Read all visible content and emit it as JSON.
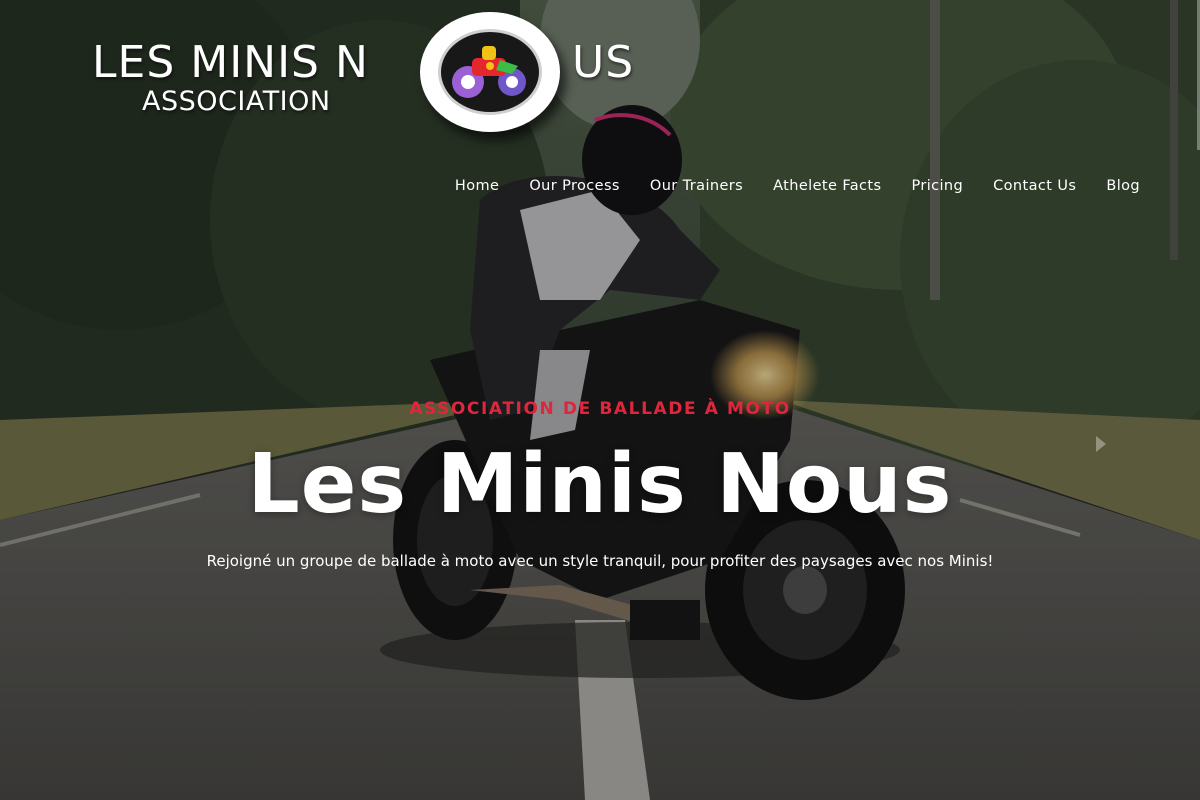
{
  "logo": {
    "line1": "LES MINIS N",
    "line1_end": "US",
    "line2": "ASSOCIATION",
    "emblem_icon": "toy-motorbike-icon"
  },
  "nav": {
    "items": [
      {
        "label": "Home"
      },
      {
        "label": "Our Process"
      },
      {
        "label": "Our Trainers"
      },
      {
        "label": "Athelete Facts"
      },
      {
        "label": "Pricing"
      },
      {
        "label": "Contact Us"
      },
      {
        "label": "Blog"
      }
    ]
  },
  "hero": {
    "eyebrow": "ASSOCIATION DE BALLADE À MOTO",
    "title": "Les Minis Nous",
    "subtitle": "Rejoigné un groupe de ballade à moto avec un style tranquil, pour profiter des paysages avec nos Minis!",
    "background": "motorcycle-rider-on-forest-road"
  },
  "colors": {
    "accent": "#e0263d",
    "text": "#ffffff"
  }
}
